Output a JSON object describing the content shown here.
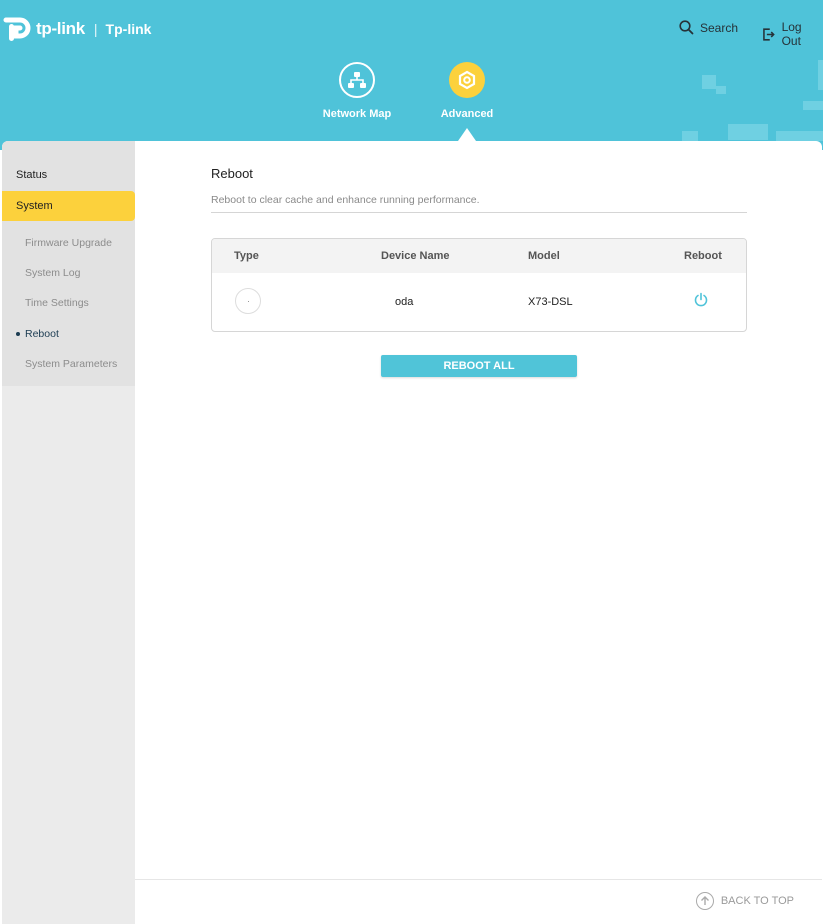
{
  "header": {
    "brand": "tp-link",
    "product": "Tp-link",
    "search_label": "Search",
    "logout_label": "Log Out",
    "tabs": [
      {
        "label": "Network Map",
        "active": false
      },
      {
        "label": "Advanced",
        "active": true
      }
    ]
  },
  "sidebar": {
    "items": [
      {
        "label": "Status"
      },
      {
        "label": "System"
      }
    ],
    "subitems": [
      {
        "label": "Firmware Upgrade"
      },
      {
        "label": "System Log"
      },
      {
        "label": "Time Settings"
      },
      {
        "label": "Reboot"
      },
      {
        "label": "System Parameters"
      }
    ]
  },
  "main": {
    "title": "Reboot",
    "description": "Reboot to clear cache and enhance running performance.",
    "table": {
      "columns": [
        "Type",
        "Device Name",
        "Model",
        "Reboot"
      ],
      "rows": [
        {
          "device_name": "oda",
          "model": "X73-DSL"
        }
      ]
    },
    "reboot_all_label": "REBOOT ALL",
    "back_to_top_label": "BACK TO TOP"
  },
  "colors": {
    "header": "#4fc3d9",
    "accent": "#fcd13c",
    "button": "#50c4d8"
  },
  "icons": [
    "search-icon",
    "logout-icon",
    "network-map-icon",
    "advanced-gear-icon",
    "router-type-icon",
    "power-icon",
    "arrow-up-icon"
  ]
}
